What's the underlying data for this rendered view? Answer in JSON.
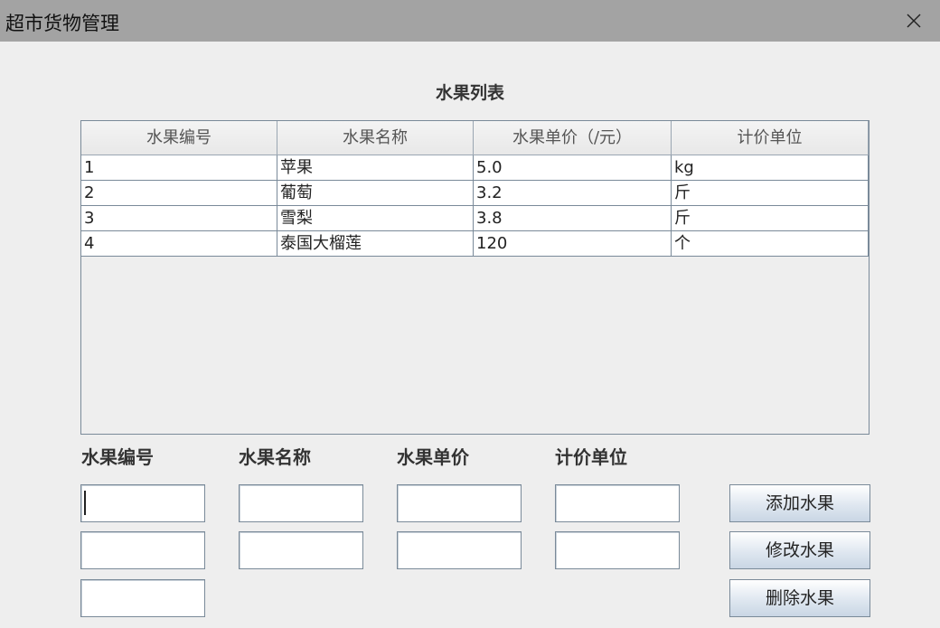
{
  "window": {
    "title": "超市货物管理"
  },
  "heading": "水果列表",
  "table": {
    "columns": [
      "水果编号",
      "水果名称",
      "水果单价（/元）",
      "计价单位"
    ],
    "rows": [
      [
        "1",
        "苹果",
        "5.0",
        "kg"
      ],
      [
        "2",
        "葡萄",
        "3.2",
        "斤"
      ],
      [
        "3",
        "雪梨",
        "3.8",
        "斤"
      ],
      [
        "4",
        "泰国大榴莲",
        "120",
        "个"
      ]
    ]
  },
  "form": {
    "labels": {
      "id": "水果编号",
      "name": "水果名称",
      "price": "水果单价",
      "unit": "计价单位"
    },
    "fields": {
      "id_add": "",
      "id_update": "",
      "id_delete": "",
      "name_add": "",
      "name_update": "",
      "price_add": "",
      "price_update": "",
      "unit_add": "",
      "unit_update": ""
    }
  },
  "buttons": {
    "add": "添加水果",
    "update": "修改水果",
    "delete": "删除水果"
  }
}
